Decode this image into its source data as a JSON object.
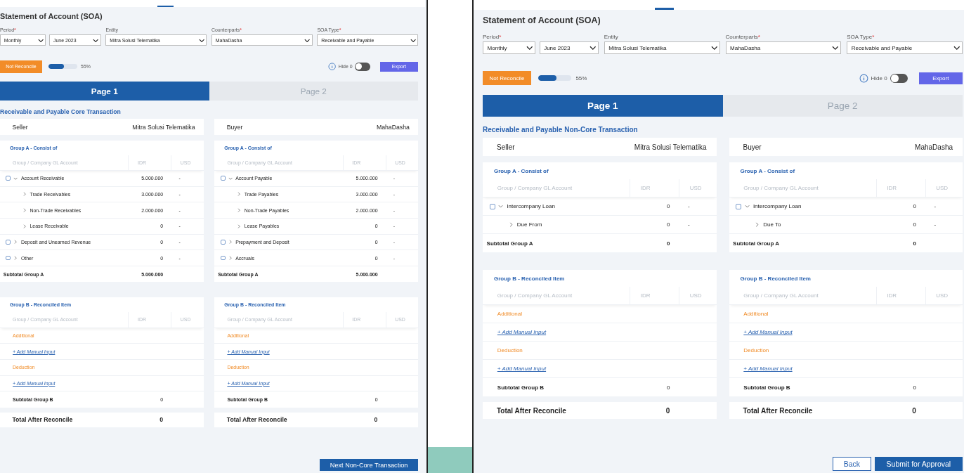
{
  "screens": [
    {
      "title": "Statement of Account (SOA)",
      "filters": [
        {
          "label": "Period",
          "required_mark": "*",
          "values": [
            "Monthly",
            "June 2023"
          ]
        },
        {
          "label": "Entity",
          "values": [
            "Mitra Solusi Telematika"
          ]
        },
        {
          "label": "Counterparts",
          "required_mark": "*",
          "values": [
            "MahaDasha"
          ]
        },
        {
          "label": "SOA Type",
          "required_mark": "*",
          "values": [
            "Receivable and Payable"
          ]
        }
      ],
      "status": "Not Reconcile",
      "progress": {
        "level": 0.55,
        "reading": "55%"
      },
      "hide": {
        "label": "Hide 0",
        "on": false
      },
      "export": "Export",
      "tabs": [
        {
          "label": "Page 1",
          "selected": true
        },
        {
          "label": "Page 2",
          "selected": false
        }
      ],
      "section_title": "Receivable and Payable Core Transaction",
      "parties": [
        {
          "role": "Seller",
          "name": "Mitra Solusi Telematika",
          "group_a": {
            "title": "Group A - Consist of",
            "columns": [
              "Group / Company GL Account",
              "IDR",
              "USD"
            ],
            "rows": [
              {
                "label": "Account Receivable",
                "idr": "5.000.000",
                "usd": "-",
                "checked": false,
                "expanded": true,
                "children": [
                  {
                    "label": "Trade Receivables",
                    "idr": "3.000.000",
                    "usd": "-",
                    "expanded": false
                  },
                  {
                    "label": "Non-Trade Receivables",
                    "idr": "2.000.000",
                    "usd": "-",
                    "expanded": false
                  },
                  {
                    "label": "Lease Receivable",
                    "idr": "0",
                    "usd": "-",
                    "expanded": false
                  }
                ]
              },
              {
                "label": "Deposit and Unearned Revenue",
                "idr": "0",
                "usd": "-",
                "checked": false,
                "expanded": false
              },
              {
                "label": "Other",
                "idr": "0",
                "usd": "-",
                "checked": false,
                "expanded": false
              }
            ],
            "subtotal_label": "Subtotal Group A",
            "subtotal_value": "5.000.000"
          },
          "group_b": {
            "title": "Group B - Reconciled Item",
            "columns": [
              "Group / Company GL Account",
              "IDR",
              "USD"
            ],
            "items": [
              {
                "kind": "category",
                "label": "Additional"
              },
              {
                "kind": "link",
                "label": "+ Add Manual Input"
              },
              {
                "kind": "category",
                "label": "Deduction"
              },
              {
                "kind": "link",
                "label": "+ Add Manual Input"
              }
            ],
            "subtotal_label": "Subtotal Group B",
            "subtotal_value": "0"
          },
          "total_label": "Total After Reconcile",
          "total_value": "0"
        },
        {
          "role": "Buyer",
          "name": "MahaDasha",
          "group_a": {
            "title": "Group A - Consist of",
            "columns": [
              "Group / Company GL Account",
              "IDR",
              "USD"
            ],
            "rows": [
              {
                "label": "Account Payable",
                "idr": "5.000.000",
                "usd": "-",
                "checked": false,
                "expanded": true,
                "children": [
                  {
                    "label": "Trade Payables",
                    "idr": "3.000.000",
                    "usd": "-",
                    "expanded": false
                  },
                  {
                    "label": "Non-Trade Payables",
                    "idr": "2.000.000",
                    "usd": "-",
                    "expanded": false
                  },
                  {
                    "label": "Lease Payables",
                    "idr": "0",
                    "usd": "-",
                    "expanded": false
                  }
                ]
              },
              {
                "label": "Prepayment and Deposit",
                "idr": "0",
                "usd": "-",
                "checked": false,
                "expanded": false
              },
              {
                "label": "Accruals",
                "idr": "0",
                "usd": "-",
                "checked": false,
                "expanded": false
              }
            ],
            "subtotal_label": "Subtotal Group A",
            "subtotal_value": "5.000.000"
          },
          "group_b": {
            "title": "Group B - Reconciled Item",
            "columns": [
              "Group / Company GL Account",
              "IDR",
              "USD"
            ],
            "items": [
              {
                "kind": "category",
                "label": "Additional"
              },
              {
                "kind": "link",
                "label": "+ Add Manual Input"
              },
              {
                "kind": "category",
                "label": "Deduction"
              },
              {
                "kind": "link",
                "label": "+ Add Manual Input"
              }
            ],
            "subtotal_label": "Subtotal Group B",
            "subtotal_value": "0"
          },
          "total_label": "Total After Reconcile",
          "total_value": "0"
        }
      ],
      "actions": [
        {
          "label": "Next Non-Core Transaction",
          "kind": "primary"
        }
      ]
    },
    {
      "title": "Statement of Account (SOA)",
      "filters": [
        {
          "label": "Period",
          "required_mark": "*",
          "values": [
            "Monthly",
            "June 2023"
          ]
        },
        {
          "label": "Entity",
          "values": [
            "Mitra Solusi Telematika"
          ]
        },
        {
          "label": "Counterparts",
          "required_mark": "*",
          "values": [
            "MahaDasha"
          ]
        },
        {
          "label": "SOA Type",
          "required_mark": "*",
          "values": [
            "Receivable and Payable"
          ]
        }
      ],
      "status": "Not Reconcile",
      "progress": {
        "level": 0.55,
        "reading": "55%"
      },
      "hide": {
        "label": "Hide 0",
        "on": false
      },
      "export": "Export",
      "tabs": [
        {
          "label": "Page 1",
          "selected": true
        },
        {
          "label": "Page 2",
          "selected": false
        }
      ],
      "section_title": "Receivable and Payable Non-Core Transaction",
      "parties": [
        {
          "role": "Seller",
          "name": "Mitra Solusi Telematika",
          "group_a": {
            "title": "Group A - Consist of",
            "columns": [
              "Group / Company GL Account",
              "IDR",
              "USD"
            ],
            "rows": [
              {
                "label": "Intercompany Loan",
                "idr": "0",
                "usd": "-",
                "checked": false,
                "expanded": true,
                "children": [
                  {
                    "label": "Due From",
                    "idr": "0",
                    "usd": "-",
                    "expanded": false
                  }
                ]
              }
            ],
            "subtotal_label": "Subtotal Group A",
            "subtotal_value": "0"
          },
          "group_b": {
            "title": "Group B - Reconciled Item",
            "columns": [
              "Group / Company GL Account",
              "IDR",
              "USD"
            ],
            "items": [
              {
                "kind": "category",
                "label": "Additional"
              },
              {
                "kind": "link",
                "label": "+ Add Manual Input"
              },
              {
                "kind": "category",
                "label": "Deduction"
              },
              {
                "kind": "link",
                "label": "+ Add Manual Input"
              }
            ],
            "subtotal_label": "Subtotal Group B",
            "subtotal_value": "0"
          },
          "total_label": "Total After Reconcile",
          "total_value": "0"
        },
        {
          "role": "Buyer",
          "name": "MahaDasha",
          "group_a": {
            "title": "Group A - Consist of",
            "columns": [
              "Group / Company GL Account",
              "IDR",
              "USD"
            ],
            "rows": [
              {
                "label": "Intercompany Loan",
                "idr": "0",
                "usd": "-",
                "checked": false,
                "expanded": true,
                "children": [
                  {
                    "label": "Due To",
                    "idr": "0",
                    "usd": "-",
                    "expanded": false
                  }
                ]
              }
            ],
            "subtotal_label": "Subtotal Group A",
            "subtotal_value": "0"
          },
          "group_b": {
            "title": "Group B - Reconciled Item",
            "columns": [
              "Group / Company GL Account",
              "IDR",
              "USD"
            ],
            "items": [
              {
                "kind": "category",
                "label": "Additional"
              },
              {
                "kind": "link",
                "label": "+ Add Manual Input"
              },
              {
                "kind": "category",
                "label": "Deduction"
              },
              {
                "kind": "link",
                "label": "+ Add Manual Input"
              }
            ],
            "subtotal_label": "Subtotal Group B",
            "subtotal_value": "0"
          },
          "total_label": "Total After Reconcile",
          "total_value": "0"
        }
      ],
      "actions": [
        {
          "label": "Back",
          "kind": "secondary"
        },
        {
          "label": "Submit for Approval",
          "kind": "primary"
        }
      ]
    }
  ]
}
